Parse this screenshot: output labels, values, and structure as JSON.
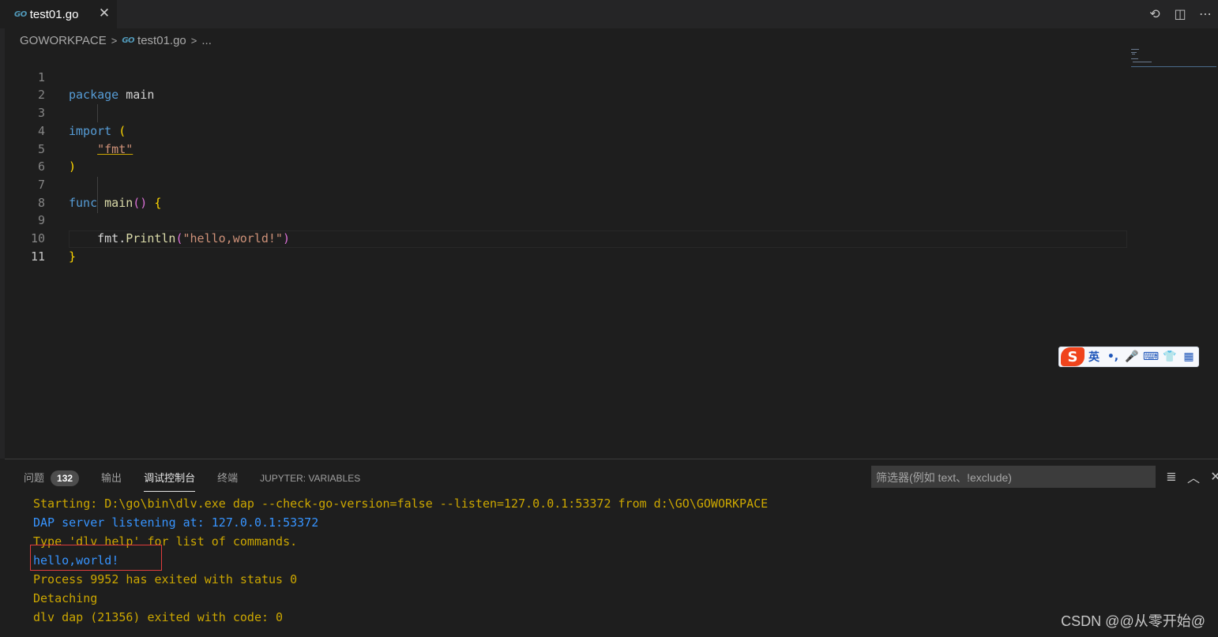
{
  "tab": {
    "badge": "GO",
    "title": "test01.go",
    "close": "✕"
  },
  "tab_actions": {
    "timeline": "⟲",
    "split": "◫",
    "more": "⋯"
  },
  "breadcrumb": {
    "folder": "GOWORKPACE",
    "sep": ">",
    "badge": "GO",
    "file": "test01.go",
    "sep2": ">",
    "ellipsis": "..."
  },
  "editor": {
    "line_numbers": [
      "1",
      "2",
      "3",
      "4",
      "5",
      "6",
      "7",
      "8",
      "9",
      "10",
      "11"
    ],
    "active_line": "11",
    "code": {
      "l1_kw": "package",
      "l1_name": " main",
      "l3_kw": "import",
      "l3_paren": " (",
      "l4_str": "\"fmt\"",
      "l5_paren": ")",
      "l7_kw": "func",
      "l7_fn": " main",
      "l7_paren": "()",
      "l7_brace": " {",
      "l9_obj": "fmt.",
      "l9_fn": "Println",
      "l9_open": "(",
      "l9_str": "\"hello,world!\"",
      "l9_close": ")",
      "l10_brace": "}"
    }
  },
  "ime": {
    "logo": "S",
    "lang": "英",
    "punct": "•,",
    "mic": "🎤",
    "keyboard": "⌨",
    "skin": "👕",
    "apps": "▦"
  },
  "panel": {
    "tabs": [
      {
        "label": "问题",
        "badge": "132"
      },
      {
        "label": "输出"
      },
      {
        "label": "调试控制台"
      },
      {
        "label": "终端"
      },
      {
        "label": "JUPYTER: VARIABLES"
      }
    ],
    "filter_placeholder": "筛选器(例如 text、!exclude)",
    "actions": {
      "clear": "≣",
      "maximize": "︿",
      "close": "✕"
    }
  },
  "console": {
    "lines": [
      "Starting: D:\\go\\bin\\dlv.exe dap --check-go-version=false --listen=127.0.0.1:53372 from d:\\GO\\GOWORKPACE",
      "DAP server listening at: 127.0.0.1:53372",
      "Type 'dlv help' for list of commands.",
      "hello,world!",
      "Process 9952 has exited with status 0",
      "Detaching",
      "dlv dap (21356) exited with code: 0"
    ]
  },
  "colors": {
    "keyword": "#569cd6",
    "function": "#dcdcaa",
    "string": "#ce9178",
    "console_orange": "#cca700",
    "console_blue": "#3794ff",
    "highlight_box": "#e03c3c"
  },
  "watermark": "CSDN @@从零开始@"
}
